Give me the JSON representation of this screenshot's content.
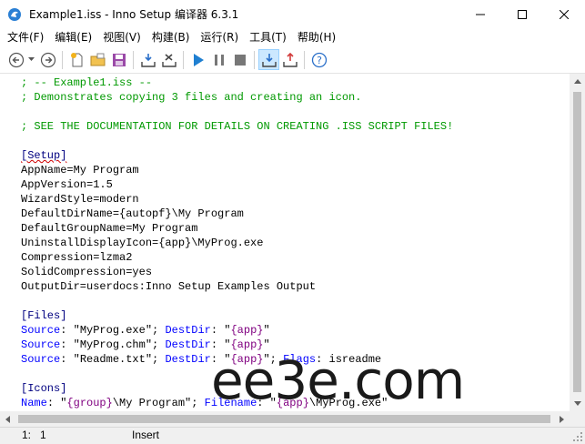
{
  "window": {
    "title": "Example1.iss - Inno Setup 编译器 6.3.1"
  },
  "menu": [
    "文件(F)",
    "编辑(E)",
    "视图(V)",
    "构建(B)",
    "运行(R)",
    "工具(T)",
    "帮助(H)"
  ],
  "toolbar_icons": [
    "back-icon",
    "dropdown-arrow-icon",
    "forward-icon",
    "new-file-icon",
    "open-folder-icon",
    "save-icon",
    "compile-icon",
    "stop-compile-icon",
    "run-icon",
    "pause-icon",
    "stop-icon",
    "target-setup-icon",
    "target-uninstall-icon",
    "help-icon"
  ],
  "editor": {
    "lines": [
      [
        {
          "t": "; -- Example1.iss --",
          "c": "comment"
        }
      ],
      [
        {
          "t": "; Demonstrates copying 3 files and creating an icon.",
          "c": "comment"
        }
      ],
      [
        {
          "t": "",
          "c": "text"
        }
      ],
      [
        {
          "t": "; SEE THE DOCUMENTATION FOR DETAILS ON CREATING .ISS SCRIPT FILES!",
          "c": "comment"
        }
      ],
      [
        {
          "t": "",
          "c": "text"
        }
      ],
      [
        {
          "t": "[Setup]",
          "c": "section-underline"
        }
      ],
      [
        {
          "t": "AppName=My Program",
          "c": "text"
        }
      ],
      [
        {
          "t": "AppVersion=1.5",
          "c": "text"
        }
      ],
      [
        {
          "t": "WizardStyle=modern",
          "c": "text"
        }
      ],
      [
        {
          "t": "DefaultDirName={autopf}\\My Program",
          "c": "text"
        }
      ],
      [
        {
          "t": "DefaultGroupName=My Program",
          "c": "text"
        }
      ],
      [
        {
          "t": "UninstallDisplayIcon={app}\\MyProg.exe",
          "c": "text"
        }
      ],
      [
        {
          "t": "Compression=lzma2",
          "c": "text"
        }
      ],
      [
        {
          "t": "SolidCompression=yes",
          "c": "text"
        }
      ],
      [
        {
          "t": "OutputDir=userdocs:Inno Setup Examples Output",
          "c": "text"
        }
      ],
      [
        {
          "t": "",
          "c": "text"
        }
      ],
      [
        {
          "t": "[Files]",
          "c": "section"
        }
      ],
      [
        {
          "t": "Source",
          "c": "param"
        },
        {
          "t": ": \"MyProg.exe\"; ",
          "c": "text"
        },
        {
          "t": "DestDir",
          "c": "param"
        },
        {
          "t": ": \"",
          "c": "text"
        },
        {
          "t": "{app}",
          "c": "const"
        },
        {
          "t": "\"",
          "c": "text"
        }
      ],
      [
        {
          "t": "Source",
          "c": "param"
        },
        {
          "t": ": \"MyProg.chm\"; ",
          "c": "text"
        },
        {
          "t": "DestDir",
          "c": "param"
        },
        {
          "t": ": \"",
          "c": "text"
        },
        {
          "t": "{app}",
          "c": "const"
        },
        {
          "t": "\"",
          "c": "text"
        }
      ],
      [
        {
          "t": "Source",
          "c": "param"
        },
        {
          "t": ": \"Readme.txt\"; ",
          "c": "text"
        },
        {
          "t": "DestDir",
          "c": "param"
        },
        {
          "t": ": \"",
          "c": "text"
        },
        {
          "t": "{app}",
          "c": "const"
        },
        {
          "t": "\"; ",
          "c": "text"
        },
        {
          "t": "Flags",
          "c": "param"
        },
        {
          "t": ": isreadme",
          "c": "text"
        }
      ],
      [
        {
          "t": "",
          "c": "text"
        }
      ],
      [
        {
          "t": "[Icons]",
          "c": "section"
        }
      ],
      [
        {
          "t": "Name",
          "c": "param"
        },
        {
          "t": ": \"",
          "c": "text"
        },
        {
          "t": "{group}",
          "c": "const"
        },
        {
          "t": "\\My Program\"; ",
          "c": "text"
        },
        {
          "t": "Filename",
          "c": "param"
        },
        {
          "t": ": \"",
          "c": "text"
        },
        {
          "t": "{app}",
          "c": "const"
        },
        {
          "t": "\\MyProg.exe\"",
          "c": "text"
        }
      ]
    ]
  },
  "status": {
    "position": "1:   1",
    "mode": "Insert"
  },
  "watermark": "ee3e.com",
  "colors": {
    "comment": "#009900",
    "section": "#000080",
    "param": "#0000ff",
    "const": "#800080",
    "active_button": "#cce8ff"
  }
}
